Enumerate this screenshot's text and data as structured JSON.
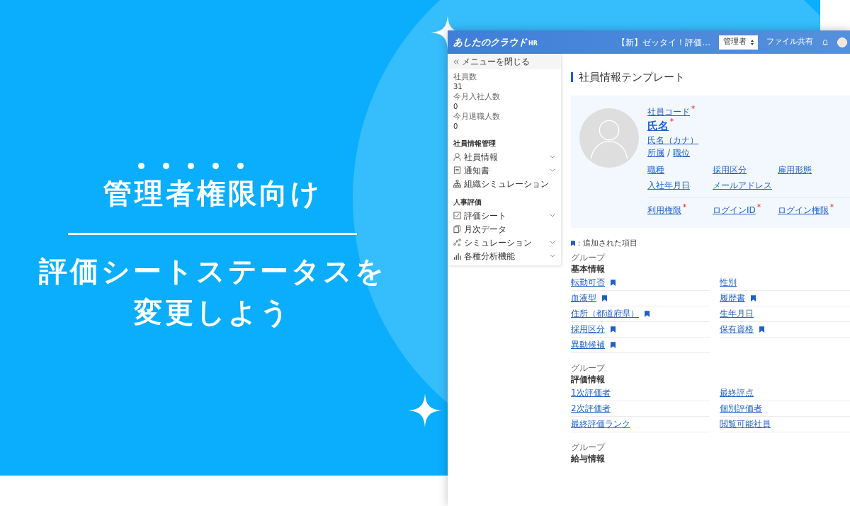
{
  "banner": {
    "headline": "管理者権限向け",
    "subtitle_lines": [
      "評価シートステータスを",
      "変更しよう"
    ]
  },
  "app": {
    "logo": "あしたのクラウド",
    "logo_suffix": "HR",
    "header": {
      "notice": "【新】ゼッタイ！評価…",
      "role_select": "管理者",
      "file_share": "ファイル共有"
    },
    "sidebar": {
      "close_menu": "メニューを閉じる",
      "stats": [
        {
          "label": "社員数",
          "value": "31"
        },
        {
          "label": "今月入社人数",
          "value": "0"
        },
        {
          "label": "今月退職人数",
          "value": "0"
        }
      ],
      "sections": [
        {
          "title": "社員情報管理",
          "items": [
            {
              "kind": "person",
              "label": "社員情報",
              "expandable": true
            },
            {
              "kind": "document",
              "label": "通知書",
              "expandable": true
            },
            {
              "kind": "org",
              "label": "組織シミュレーション",
              "expandable": false
            }
          ]
        },
        {
          "title": "人事評価",
          "items": [
            {
              "kind": "check",
              "label": "評価シート",
              "expandable": true
            },
            {
              "kind": "copy",
              "label": "月次データ",
              "expandable": false
            },
            {
              "kind": "scatter",
              "label": "シミュレーション",
              "expandable": true
            },
            {
              "kind": "bars",
              "label": "各種分析機能",
              "expandable": true
            }
          ]
        }
      ]
    },
    "page_title": "社員情報テンプレート",
    "profile": {
      "code": {
        "label": "社員コード",
        "required": true
      },
      "name": {
        "label": "氏名",
        "required": true
      },
      "kana": {
        "label": "氏名（カナ）",
        "required": false
      },
      "affiliation": "所属",
      "separator": "/",
      "position": "職位",
      "fields": [
        {
          "label": "職種",
          "required": false
        },
        {
          "label": "採用区分",
          "required": false
        },
        {
          "label": "雇用形態",
          "required": false
        },
        {
          "label": "入社年月日",
          "required": false
        },
        {
          "label": "メールアドレス",
          "required": false
        }
      ],
      "account_fields": [
        {
          "label": "利用権限",
          "required": true
        },
        {
          "label": "ログインID",
          "required": true
        },
        {
          "label": "ログイン権限",
          "required": true
        }
      ]
    },
    "legend": "：追加された項目",
    "groups": [
      {
        "caption": "グループ",
        "title": "基本情報",
        "fields": [
          {
            "label": "転勤可否",
            "added": true
          },
          {
            "label": "性別",
            "added": false
          },
          {
            "label": "血液型",
            "added": true
          },
          {
            "label": "履歴書",
            "added": true
          },
          {
            "label": "住所（都道府県）",
            "added": true
          },
          {
            "label": "生年月日",
            "added": false
          },
          {
            "label": "採用区分",
            "added": true
          },
          {
            "label": "保有資格",
            "added": true
          },
          {
            "label": "異動候補",
            "added": true
          }
        ]
      },
      {
        "caption": "グループ",
        "title": "評価情報",
        "fields": [
          {
            "label": "1次評価者",
            "added": false
          },
          {
            "label": "最終評点",
            "added": false
          },
          {
            "label": "2次評価者",
            "added": false
          },
          {
            "label": "個別評価者",
            "added": false
          },
          {
            "label": "最終評価ランク",
            "added": false
          },
          {
            "label": "閲覧可能社員",
            "added": false
          }
        ]
      },
      {
        "caption": "グループ",
        "title": "給与情報"
      }
    ]
  }
}
